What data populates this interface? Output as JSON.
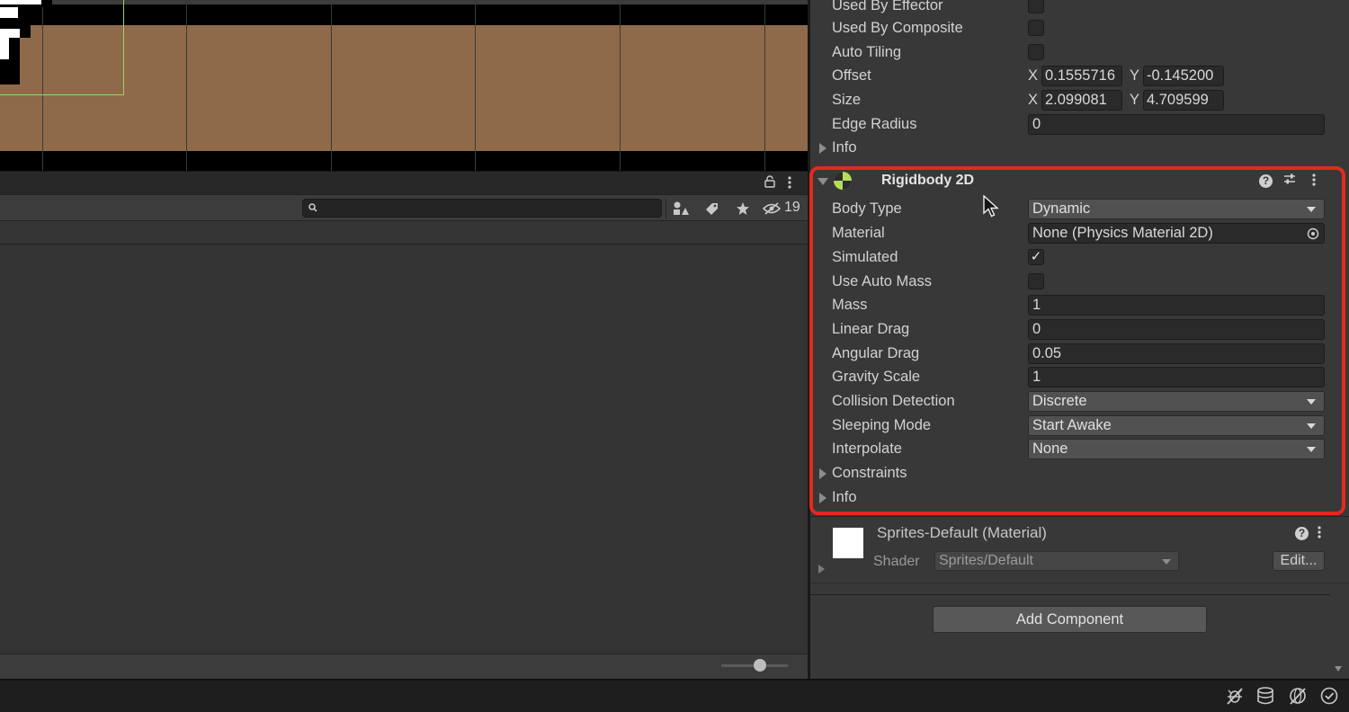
{
  "collider": {
    "rows": [
      {
        "label": "Used By Effector",
        "type": "checkbox",
        "checked": false
      },
      {
        "label": "Used By Composite",
        "type": "checkbox",
        "checked": false
      },
      {
        "label": "Auto Tiling",
        "type": "checkbox",
        "checked": false
      }
    ],
    "offset": {
      "label": "Offset",
      "x_label": "X",
      "x": "0.1555716",
      "y_label": "Y",
      "y": "-0.145200"
    },
    "size": {
      "label": "Size",
      "x_label": "X",
      "x": "2.099081",
      "y_label": "Y",
      "y": "4.709599"
    },
    "edge_radius": {
      "label": "Edge Radius",
      "value": "0"
    },
    "info": "Info"
  },
  "rigidbody": {
    "title": "Rigidbody 2D",
    "body_type": {
      "label": "Body Type",
      "value": "Dynamic"
    },
    "material": {
      "label": "Material",
      "value": "None (Physics Material 2D)"
    },
    "simulated": {
      "label": "Simulated",
      "checked": true
    },
    "use_auto_mass": {
      "label": "Use Auto Mass",
      "checked": false
    },
    "mass": {
      "label": "Mass",
      "value": "1"
    },
    "linear_drag": {
      "label": "Linear Drag",
      "value": "0"
    },
    "angular_drag": {
      "label": "Angular Drag",
      "value": "0.05"
    },
    "gravity_scale": {
      "label": "Gravity Scale",
      "value": "1"
    },
    "collision_detection": {
      "label": "Collision Detection",
      "value": "Discrete"
    },
    "sleeping_mode": {
      "label": "Sleeping Mode",
      "value": "Start Awake"
    },
    "interpolate": {
      "label": "Interpolate",
      "value": "None"
    },
    "constraints": "Constraints",
    "info": "Info",
    "checkmark": "✓"
  },
  "material_section": {
    "name": "Sprites-Default (Material)",
    "shader_label": "Shader",
    "shader_value": "Sprites/Default",
    "edit_label": "Edit..."
  },
  "add_component_label": "Add Component",
  "project": {
    "hidden_count": "19",
    "search_placeholder": ""
  },
  "colors": {
    "highlight": "#e5291f",
    "ground": "#8f6a4a",
    "rigidbody_icon": "#b6dc58",
    "collider_outline": "#9bd26a"
  },
  "icons": {
    "search": "search-icon",
    "lock": "lock-icon",
    "kebab": "kebab-menu-icon",
    "help": "help-icon",
    "presets": "presets-icon",
    "star": "star-icon",
    "label": "label-icon",
    "eye_hidden": "eye-hidden-icon"
  }
}
